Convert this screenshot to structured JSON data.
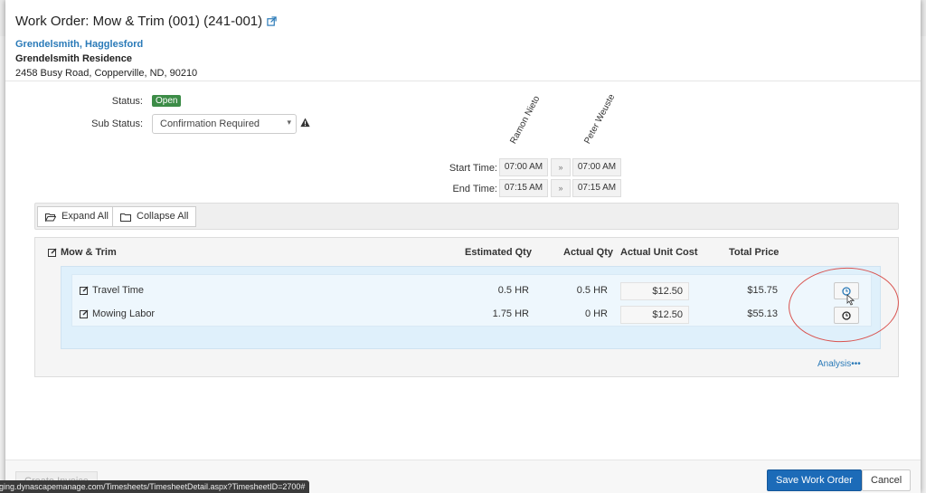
{
  "modal": {
    "title": "Work Order: Mow & Trim (001) (241-001)",
    "customer": "Grendelsmith, Hagglesford",
    "site": "Grendelsmith Residence",
    "address": "2458 Busy Road, Copperville, ND, 90210"
  },
  "status": {
    "label": "Status:",
    "value": "Open",
    "color": "#3c8c47"
  },
  "sub_status": {
    "label": "Sub Status:",
    "selected": "Confirmation Required"
  },
  "employees": [
    "Ramon Nieto",
    "Peter Weuste"
  ],
  "times": {
    "start_label": "Start Time:",
    "end_label": "End Time:",
    "start": [
      "07:00 AM",
      "07:00 AM"
    ],
    "end": [
      "07:15 AM",
      "07:15 AM"
    ],
    "copy_symbol": "»"
  },
  "toolbar": {
    "expand_all": "Expand All",
    "collapse_all": "Collapse All"
  },
  "task": {
    "name": "Mow & Trim",
    "columns": [
      "Estimated Qty",
      "Actual Qty",
      "Actual Unit Cost",
      "Total Price"
    ],
    "rows": [
      {
        "name": "Travel Time",
        "estimated_qty": "0.5 HR",
        "actual_qty": "0.5 HR",
        "unit_cost": "$12.50",
        "total_price": "$15.75"
      },
      {
        "name": "Mowing Labor",
        "estimated_qty": "1.75 HR",
        "actual_qty": "0 HR",
        "unit_cost": "$12.50",
        "total_price": "$55.13"
      }
    ]
  },
  "analysis_link": "Analysis•••",
  "footer": {
    "create_invoice": "Create Invoice",
    "save": "Save Work Order",
    "cancel": "Cancel",
    "status_url": "ging.dynascapemanage.com/Timesheets/TimesheetDetail.aspx?TimesheetID=2700#"
  },
  "colors": {
    "accent": "#1c6bb8",
    "link": "#2a7ab8",
    "annotation": "#d9534f"
  }
}
